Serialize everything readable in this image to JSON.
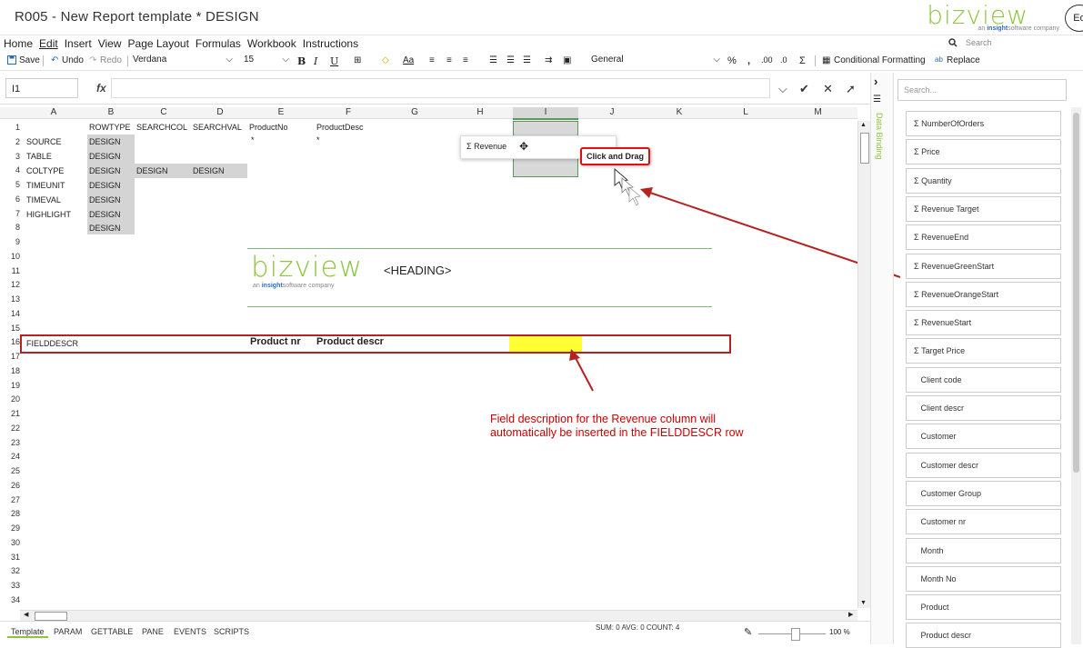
{
  "window": {
    "title": "R005 - New Report template * DESIGN",
    "logo_text": "bizview",
    "logo_sub_prefix": "an ",
    "logo_sub_brand": "insight",
    "logo_sub_suffix": "software company",
    "avatar_text": "Ed"
  },
  "menu": [
    "Home",
    "Edit",
    "Insert",
    "View",
    "Page Layout",
    "Formulas",
    "Workbook",
    "Instructions"
  ],
  "search": {
    "placeholder": "Search"
  },
  "toolbar": {
    "save": "Save",
    "undo": "Undo",
    "redo": "Redo",
    "font": "Verdana",
    "font_size": "15",
    "bold": "B",
    "italic": "I",
    "underline": "U",
    "number_format": "General",
    "percent": "%",
    "comma": ",",
    "sigma": "Σ",
    "conditional_formatting": "Conditional Formatting",
    "replace": "Replace"
  },
  "formula": {
    "cell_ref": "I1",
    "fx": "fx"
  },
  "columns": [
    "A",
    "B",
    "C",
    "D",
    "E",
    "F",
    "G",
    "H",
    "I",
    "J",
    "K",
    "L",
    "M"
  ],
  "rows": [
    "1",
    "2",
    "3",
    "4",
    "5",
    "6",
    "7",
    "8",
    "9",
    "10",
    "11",
    "12",
    "13",
    "14",
    "15",
    "16",
    "17",
    "18",
    "19",
    "20",
    "21",
    "22",
    "23",
    "24",
    "25",
    "26",
    "27",
    "28",
    "29",
    "30",
    "31",
    "32",
    "33",
    "34"
  ],
  "cells": {
    "b1": "ROWTYPE",
    "c1": "SEARCHCOL",
    "d1": "SEARCHVAL",
    "e1": "ProductNo",
    "f1": "ProductDesc",
    "a2": "SOURCE",
    "b2": "DESIGN",
    "e2": "*",
    "f2": "*",
    "a3": "TABLE",
    "b3": "DESIGN",
    "a4": "COLTYPE",
    "b4": "DESIGN",
    "c4": "DESIGN",
    "d4": "DESIGN",
    "a5": "TIMEUNIT",
    "b5": "DESIGN",
    "a6": "TIMEVAL",
    "b6": "DESIGN",
    "a7": "HIGHLIGHT",
    "b7": "DESIGN",
    "b8": "DESIGN",
    "heading": "<HEADING>",
    "a16": "FIELDDESCR",
    "e16": "Product nr",
    "f16": "Product descr"
  },
  "drag": {
    "chip": "Σ Revenue",
    "label": "Click and Drag"
  },
  "annotation": "Field description for the Revenue column will automatically be inserted in the FIELDDESCR row",
  "sheets": [
    "Template",
    "PARAM",
    "GETTABLE",
    "PANE",
    "EVENTS",
    "SCRIPTS"
  ],
  "status": "SUM: 0 AVG: 0 COUNT: 4",
  "zoom": "100 %",
  "panel": {
    "tab_label": "Data Binding",
    "search_placeholder": "Search...",
    "fields": [
      {
        "label": "NumberOfOrders",
        "measure": true
      },
      {
        "label": "Price",
        "measure": true
      },
      {
        "label": "Quantity",
        "measure": true
      },
      {
        "label": "Revenue Target",
        "measure": true
      },
      {
        "label": "RevenueEnd",
        "measure": true
      },
      {
        "label": "RevenueGreenStart",
        "measure": true
      },
      {
        "label": "RevenueOrangeStart",
        "measure": true
      },
      {
        "label": "RevenueStart",
        "measure": true
      },
      {
        "label": "Target Price",
        "measure": true
      },
      {
        "label": "Client code",
        "measure": false
      },
      {
        "label": "Client descr",
        "measure": false
      },
      {
        "label": "Customer",
        "measure": false
      },
      {
        "label": "Customer descr",
        "measure": false
      },
      {
        "label": "Customer Group",
        "measure": false
      },
      {
        "label": "Customer nr",
        "measure": false
      },
      {
        "label": "Month",
        "measure": false
      },
      {
        "label": "Month No",
        "measure": false
      },
      {
        "label": "Product",
        "measure": false
      },
      {
        "label": "Product descr",
        "measure": false
      }
    ]
  },
  "colors": {
    "accent": "#8cc63f",
    "callout": "#b52222",
    "highlight": "#ffff33"
  }
}
